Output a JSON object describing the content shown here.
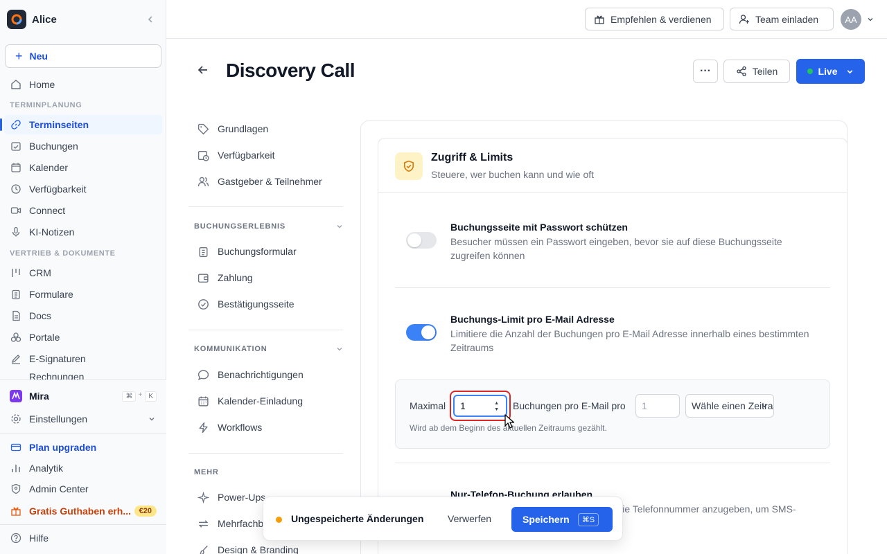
{
  "workspace": {
    "name": "Alice"
  },
  "sidebar": {
    "new_label": "Neu",
    "home": "Home",
    "section_scheduling": "TERMINPLANUNG",
    "scheduling_items": [
      {
        "label": "Terminseiten",
        "icon": "link-icon",
        "active": true
      },
      {
        "label": "Buchungen",
        "icon": "calendar-check-icon"
      },
      {
        "label": "Kalender",
        "icon": "calendar-icon"
      },
      {
        "label": "Verfügbarkeit",
        "icon": "clock-icon"
      },
      {
        "label": "Connect",
        "icon": "video-icon"
      },
      {
        "label": "KI-Notizen",
        "icon": "microphone-icon"
      }
    ],
    "section_sales": "VERTRIEB & DOKUMENTE",
    "sales_items": [
      {
        "label": "CRM",
        "icon": "crm-icon"
      },
      {
        "label": "Formulare",
        "icon": "clipboard-icon"
      },
      {
        "label": "Docs",
        "icon": "document-icon"
      },
      {
        "label": "Portale",
        "icon": "portal-icon"
      },
      {
        "label": "E-Signaturen",
        "icon": "pen-icon"
      },
      {
        "label": "Rechnungen",
        "icon": "invoice-icon"
      }
    ],
    "mira": "Mira",
    "mira_kbd": [
      "⌘",
      "+",
      "K"
    ],
    "settings": "Einstellungen",
    "upgrade": "Plan upgraden",
    "analytics": "Analytik",
    "admin": "Admin Center",
    "credit": "Gratis Guthaben erh...",
    "credit_badge": "€20",
    "help": "Hilfe"
  },
  "topbar": {
    "refer": "Empfehlen & verdienen",
    "invite": "Team einladen",
    "avatar": "AA"
  },
  "page": {
    "title": "Discovery Call",
    "share": "Teilen",
    "status": "Live",
    "more": "···"
  },
  "subnav": {
    "top": [
      "Grundlagen",
      "Verfügbarkeit",
      "Gastgeber & Teilnehmer"
    ],
    "section_booking": "BUCHUNGSERLEBNIS",
    "booking": [
      "Buchungsformular",
      "Zahlung",
      "Bestätigungsseite"
    ],
    "section_comm": "KOMMUNIKATION",
    "comm": [
      "Benachrichtigungen",
      "Kalender-Einladung",
      "Workflows"
    ],
    "section_more": "MEHR",
    "more": [
      "Power-Ups",
      "Mehrfachbuchungen",
      "Design & Branding"
    ]
  },
  "card": {
    "title": "Zugriff & Limits",
    "subtitle": "Steuere, wer buchen kann und wie oft",
    "opt1_title": "Buchungsseite mit Passwort schützen",
    "opt1_desc": "Besucher müssen ein Passwort eingeben, bevor sie auf diese Buchungsseite zugreifen können",
    "opt1_enabled": false,
    "opt2_title": "Buchungs-Limit pro E-Mail Adresse",
    "opt2_desc": "Limitiere die Anzahl der Buchungen pro E-Mail Adresse innerhalb eines bestimmten Zeitraums",
    "opt2_enabled": true,
    "limit_label_max": "Maximal",
    "limit_value": "1",
    "limit_label_per": "Buchungen pro E-Mail pro",
    "period_placeholder": "1",
    "period_select": "Wähle einen Zeitraum",
    "limit_hint": "Wird ab dem Beginn des aktuellen Zeitraums gezählt.",
    "opt3_title": "Nur-Telefon-Buchung erlauben",
    "opt3_desc": "Erlaube Gästen, zu buchen, nur durch die Telefonnummer anzugeben, um SMS-Bestätigungen zu versenden."
  },
  "unsaved": {
    "message": "Ungespeicherte Änderungen",
    "discard": "Verwerfen",
    "save": "Speichern",
    "save_kbd": "⌘S"
  },
  "colors": {
    "accent": "#2563eb",
    "live": "#22c55e",
    "warning": "#f59e0b",
    "focus_ring": "#dc2626"
  }
}
